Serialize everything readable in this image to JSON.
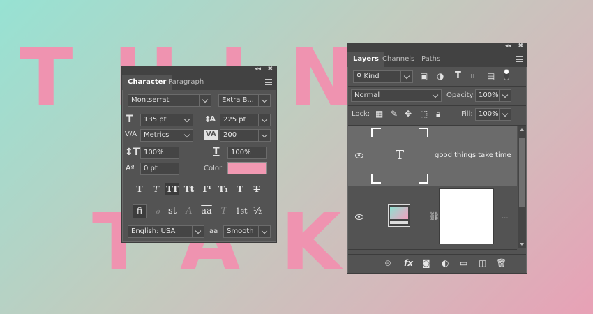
{
  "canvas": {
    "line1": "THING",
    "line2": "TAKE"
  },
  "character_panel": {
    "collapse": "◂◂",
    "close": "✖",
    "tabs": [
      {
        "label": "Character",
        "active": true
      },
      {
        "label": "Paragraph",
        "active": false
      }
    ],
    "font_family": "Montserrat",
    "font_style": "Extra B...",
    "font_size": "135 pt",
    "leading": "225 pt",
    "kerning": "Metrics",
    "tracking": "200",
    "vertical_scale": "100%",
    "horizontal_scale": "100%",
    "baseline_shift": "0 pt",
    "color_label": "Color:",
    "color_swatch": "#f199b2",
    "type_style_buttons": [
      {
        "glyph": "T",
        "name": "faux-bold"
      },
      {
        "glyph": "T",
        "name": "faux-italic"
      },
      {
        "glyph": "TT",
        "name": "all-caps",
        "active": true
      },
      {
        "glyph": "Tt",
        "name": "small-caps"
      },
      {
        "glyph": "T¹",
        "name": "superscript"
      },
      {
        "glyph": "T₁",
        "name": "subscript"
      },
      {
        "glyph": "T",
        "name": "underline"
      },
      {
        "glyph": "T",
        "name": "strikethrough"
      }
    ],
    "opentype_buttons": [
      {
        "glyph": "fi",
        "name": "standard-ligatures",
        "active": true
      },
      {
        "glyph": "ℴ",
        "name": "contextual-alternates",
        "dim": true
      },
      {
        "glyph": "st",
        "name": "discretionary-ligatures"
      },
      {
        "glyph": "A",
        "name": "swash",
        "dim": true
      },
      {
        "glyph": "aa",
        "name": "stylistic-alternates"
      },
      {
        "glyph": "T",
        "name": "titling-alternates",
        "dim": true
      },
      {
        "glyph": "1st",
        "name": "ordinals"
      },
      {
        "glyph": "½",
        "name": "fractions"
      }
    ],
    "language": "English: USA",
    "antialias_icon": "aa",
    "antialias": "Smooth"
  },
  "layers_panel": {
    "collapse": "◂◂",
    "close": "✖",
    "tabs": [
      {
        "label": "Layers",
        "active": true
      },
      {
        "label": "Channels",
        "active": false
      },
      {
        "label": "Paths",
        "active": false
      }
    ],
    "filter_kind": "Kind",
    "blend_mode": "Normal",
    "opacity_label": "Opacity:",
    "opacity": "100%",
    "lock_label": "Lock:",
    "fill_label": "Fill:",
    "fill": "100%",
    "layers": [
      {
        "name": "good things take time",
        "type": "text",
        "thumb_glyph": "T",
        "selected": true
      },
      {
        "name": "",
        "type": "gradient-fill",
        "more": "..."
      }
    ]
  },
  "colors": {
    "accent_pink": "#ef93b0",
    "panel_bg": "#535353"
  }
}
